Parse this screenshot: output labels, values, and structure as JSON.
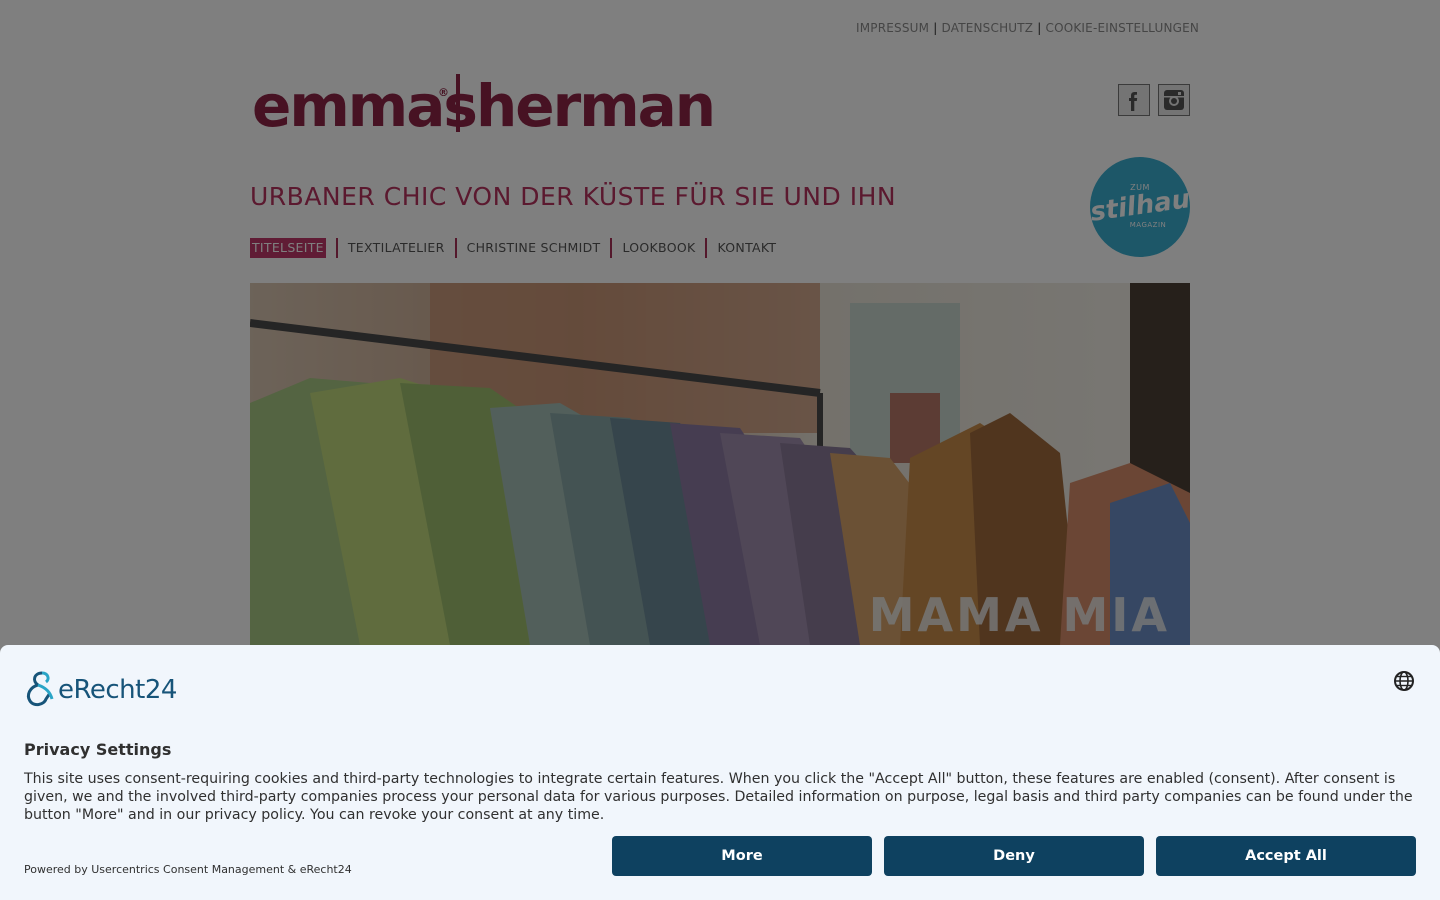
{
  "top_links": {
    "items": [
      "IMPRESSUM",
      "DATENSCHUTZ",
      "COOKIE-EINSTELLUNGEN"
    ],
    "separator": "|"
  },
  "logo": {
    "word1": "emmas",
    "registered": "®",
    "word2": "herman",
    "color": "#8e2446"
  },
  "social": {
    "facebook_icon": "facebook-icon",
    "instagram_icon": "instagram-icon"
  },
  "tagline": "URBANER CHIC VON DER KÜSTE FÜR SIE UND IHN",
  "stilhaus_badge": {
    "top": "ZUM",
    "main": "stilhaus",
    "bottom": "MAGAZIN",
    "color": "#3aaed0"
  },
  "nav": {
    "items": [
      "TITELSEITE",
      "TEXTILATELIER",
      "CHRISTINE SCHMIDT",
      "LOOKBOOK",
      "KONTAKT"
    ],
    "active_index": 0,
    "accent": "#c0396b"
  },
  "hero": {
    "caption": "MAMA MIA"
  },
  "consent": {
    "brand": "eRecht24",
    "title": "Privacy Settings",
    "body": "This site uses consent-requiring cookies and third-party technologies to integrate certain features. When you click the \"Accept All\" button, these features are enabled (consent). After consent is given, we and the involved third-party companies process your personal data for various purposes. Detailed information on purpose, legal basis and third party companies can be found under the button \"More\" and in our privacy policy. You can revoke your consent at any time.",
    "powered_by": "Powered by Usercentrics Consent Management & eRecht24",
    "buttons": {
      "more": "More",
      "deny": "Deny",
      "accept": "Accept All"
    },
    "button_color": "#0e4160",
    "globe_icon": "globe-icon"
  }
}
